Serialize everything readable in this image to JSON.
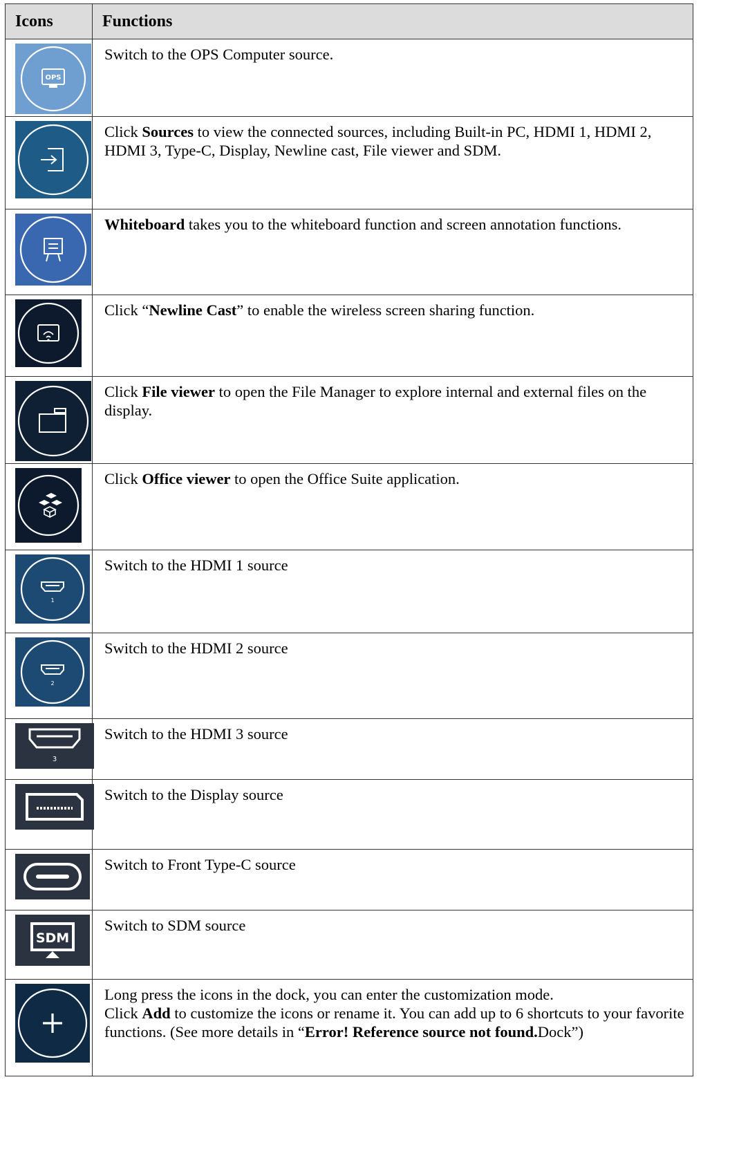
{
  "table": {
    "headers": {
      "icons": "Icons",
      "functions": "Functions"
    },
    "rows": [
      {
        "icon": "ops-monitor-icon",
        "bg": "#6f9ed0",
        "parts": [
          {
            "t": "Switch to the OPS Computer source.",
            "b": false
          }
        ]
      },
      {
        "icon": "sources-input-icon",
        "bg": "#1e5b86",
        "parts": [
          {
            "t": "Click ",
            "b": false
          },
          {
            "t": "Sources",
            "b": true
          },
          {
            "t": " to view the connected sources, including Built-in PC, HDMI 1, HDMI 2, HDMI 3, Type-C, Display, Newline cast, File viewer and SDM.",
            "b": false
          }
        ]
      },
      {
        "icon": "whiteboard-easel-icon",
        "bg": "#3a68b0",
        "parts": [
          {
            "t": "Whiteboard",
            "b": true
          },
          {
            "t": " takes you to the whiteboard function and screen annotation functions.",
            "b": false
          }
        ]
      },
      {
        "icon": "newline-cast-icon",
        "bg": "#0d1a2e",
        "parts": [
          {
            "t": "Click “",
            "b": false
          },
          {
            "t": "Newline Cast",
            "b": true
          },
          {
            "t": "” to enable the wireless screen sharing function.",
            "b": false
          }
        ]
      },
      {
        "icon": "file-viewer-folder-icon",
        "bg": "#0f2035",
        "parts": [
          {
            "t": "Click ",
            "b": false
          },
          {
            "t": "File viewer",
            "b": true
          },
          {
            "t": " to open the File Manager to explore internal and external files on the display.",
            "b": false
          }
        ]
      },
      {
        "icon": "office-viewer-cubes-icon",
        "bg": "#0d1a2e",
        "parts": [
          {
            "t": "Click ",
            "b": false
          },
          {
            "t": "Office viewer",
            "b": true
          },
          {
            "t": " to open the Office Suite application.",
            "b": false
          }
        ]
      },
      {
        "icon": "hdmi-1-icon",
        "bg": "#1d4a72",
        "port_label": "1",
        "parts": [
          {
            "t": "Switch to the HDMI 1 source",
            "b": false
          }
        ]
      },
      {
        "icon": "hdmi-2-icon",
        "bg": "#1d4a72",
        "port_label": "2",
        "parts": [
          {
            "t": "Switch to the HDMI 2 source",
            "b": false
          }
        ]
      },
      {
        "icon": "hdmi-3-icon",
        "bg": "#2b3340",
        "port_label": "3",
        "parts": [
          {
            "t": "Switch to the HDMI 3 source",
            "b": false
          }
        ]
      },
      {
        "icon": "displayport-icon",
        "bg": "#2b3340",
        "parts": [
          {
            "t": "Switch to the Display source",
            "b": false
          }
        ]
      },
      {
        "icon": "type-c-port-icon",
        "bg": "#2b3340",
        "parts": [
          {
            "t": "Switch to Front Type-C source",
            "b": false
          }
        ]
      },
      {
        "icon": "sdm-monitor-icon",
        "bg": "#2b3340",
        "icon_label": "SDM",
        "parts": [
          {
            "t": "Switch to SDM source",
            "b": false
          }
        ]
      },
      {
        "icon": "add-plus-icon",
        "bg": "#0f2a45",
        "parts": [
          {
            "t": "Long press the icons in the dock, you can enter the customization mode.\nClick ",
            "b": false
          },
          {
            "t": "Add",
            "b": true
          },
          {
            "t": " to customize the icons or rename it. You can add up to 6 shortcuts to your favorite functions. (See more details in “",
            "b": false
          },
          {
            "t": "Error! Reference source not found.",
            "b": true
          },
          {
            "t": "Dock”)",
            "b": false
          }
        ]
      }
    ]
  }
}
